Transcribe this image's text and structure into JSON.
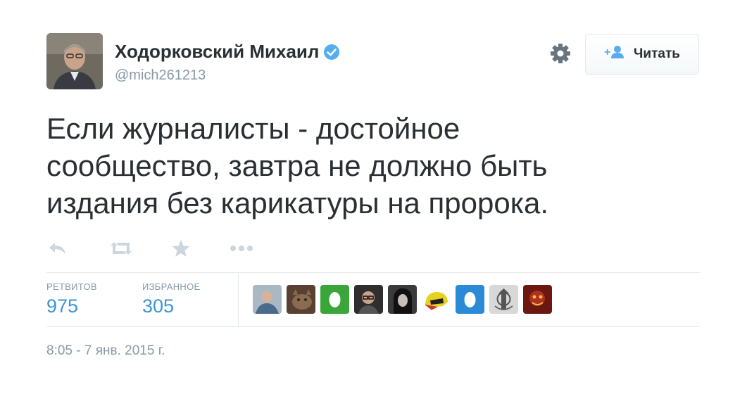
{
  "author": {
    "display_name": "Ходорковский Михаил",
    "username": "@mich261213",
    "verified": true
  },
  "header": {
    "follow_label": "Читать",
    "follow_icon": "add-user-icon",
    "settings_icon": "gear-icon"
  },
  "tweet": {
    "text": "Если журналисты - достойное\nсообщество, завтра не должно быть\nиздания без карикатуры на пророка."
  },
  "actions": [
    {
      "name": "reply",
      "icon": "reply-icon"
    },
    {
      "name": "retweet",
      "icon": "retweet-icon"
    },
    {
      "name": "favorite",
      "icon": "star-icon"
    },
    {
      "name": "more",
      "icon": "more-icon"
    }
  ],
  "stats": {
    "retweets_label": "РЕТВИТОВ",
    "retweets_value": "975",
    "favorites_label": "ИЗБРАННОЕ",
    "favorites_value": "305"
  },
  "favoriters": [
    "user-photo",
    "cat-photo",
    "default-egg-green",
    "user-photo-glasses",
    "user-photo-dark",
    "helmet-photo",
    "default-egg-blue",
    "emblem-photo",
    "red-art-photo"
  ],
  "timestamp": "8:05 - 7 янв. 2015 г.",
  "colors": {
    "link": "#3b94d9",
    "verified": "#55acee",
    "muted": "#8899a6",
    "text": "#292f33",
    "border": "#e1e8ed"
  }
}
